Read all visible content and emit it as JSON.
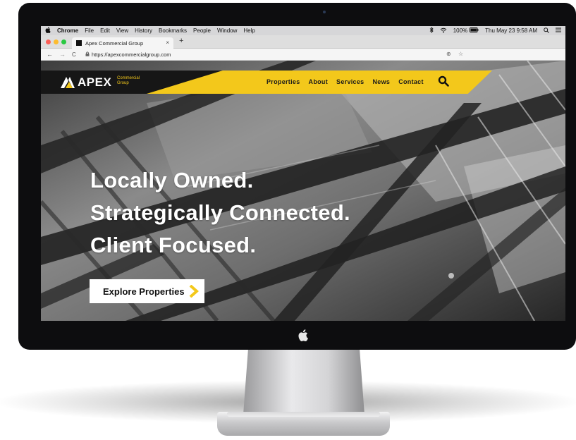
{
  "menubar": {
    "apple": "",
    "items": [
      "Chrome",
      "File",
      "Edit",
      "View",
      "History",
      "Bookmarks",
      "People",
      "Window",
      "Help"
    ],
    "battery": "100%",
    "datetime": "Thu May 23  9:58 AM"
  },
  "browser": {
    "tab_title": "Apex Commercial Group",
    "tab_close": "×",
    "new_tab": "+",
    "back": "←",
    "forward": "→",
    "reload": "C",
    "url": "https://apexcommercialgroup.com",
    "zoom_icon": "⊕",
    "bookmark_icon": "☆"
  },
  "site": {
    "logo_name": "APEX",
    "logo_sub_1": "Commercial",
    "logo_sub_2": "Group",
    "nav": [
      "Properties",
      "About",
      "Services",
      "News",
      "Contact"
    ],
    "headline_1": "Locally Owned.",
    "headline_2": "Strategically Connected.",
    "headline_3": "Client Focused.",
    "cta": "Explore Properties"
  },
  "colors": {
    "brand_yellow": "#f3c81b",
    "header_black": "#161616"
  }
}
